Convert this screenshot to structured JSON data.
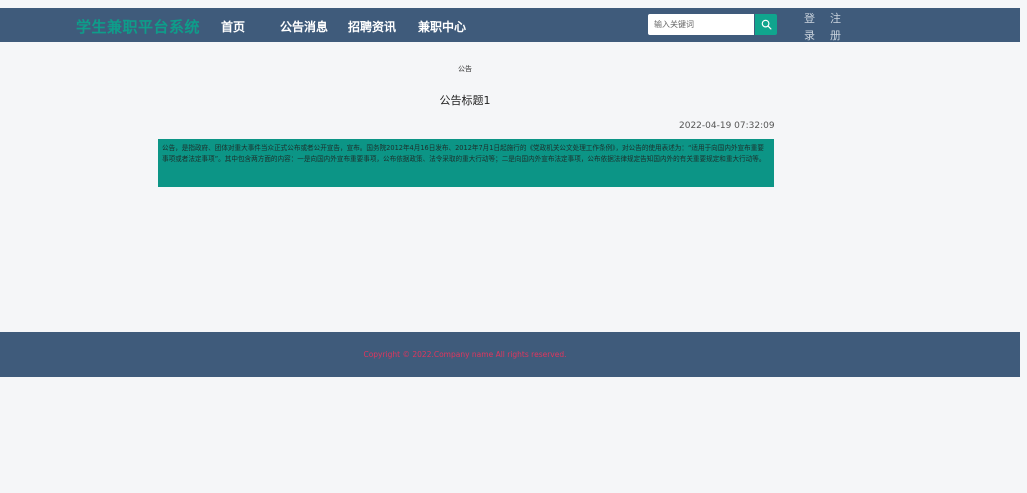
{
  "header": {
    "brand": "学生兼职平台系统",
    "nav": [
      "首页",
      "公告消息",
      "招聘资讯",
      "兼职中心"
    ],
    "search_placeholder": "输入关键词",
    "login_1": "登",
    "login_2": "录",
    "register_1": "注",
    "register_2": "册"
  },
  "main": {
    "breadcrumb": "公告",
    "title": "公告标题1",
    "date": "2022-04-19 07:32:09",
    "body": "公告，是指政府、团体对重大事件当众正式公布或者公开宣告，宣布。国务院2012年4月16日发布、2012年7月1日起施行的《党政机关公文处理工作条例》，对公告的使用表述为：“适用于向国内外宣布重要事项或者法定事项”。其中包含两方面的内容：一是向国内外宣布重要事项，公布依据政策、法令采取的重大行动等；二是向国内外宣布法定事项，公布依据法律规定告知国内外的有关重要规定和重大行动等。"
  },
  "footer": {
    "copyright": "Copyright © 2022.Company name All rights reserved."
  },
  "colors": {
    "navbar": "#3f5b7b",
    "brand": "#0e9d8a",
    "accent": "#10a58e",
    "copyright": "#e0355e"
  }
}
